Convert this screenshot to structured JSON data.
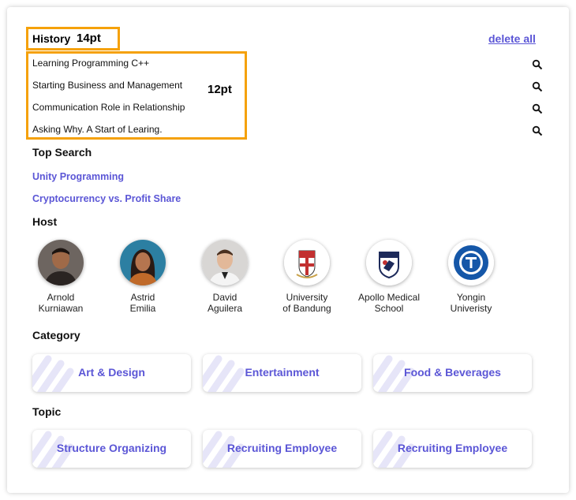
{
  "annotations": {
    "history_size": "14pt",
    "items_size": "12pt"
  },
  "history": {
    "title": "History",
    "delete_label": "delete all",
    "items": [
      "Learning Programming C++",
      "Starting Business and Management",
      "Communication Role in Relationship",
      "Asking Why. A Start of Learing."
    ]
  },
  "top_search": {
    "title": "Top Search",
    "items": [
      "Unity Programming",
      "Cryptocurrency vs. Profit Share"
    ]
  },
  "host": {
    "title": "Host",
    "items": [
      {
        "line1": "Arnold",
        "line2": "Kurniawan"
      },
      {
        "line1": "Astrid",
        "line2": "Emilia"
      },
      {
        "line1": "David",
        "line2": "Aguilera"
      },
      {
        "line1": "University",
        "line2": "of Bandung"
      },
      {
        "line1": "Apollo Medical",
        "line2": "School"
      },
      {
        "line1": "Yongin",
        "line2": "Univeristy"
      }
    ]
  },
  "category": {
    "title": "Category",
    "items": [
      "Art & Design",
      "Entertainment",
      "Food & Beverages"
    ]
  },
  "topic": {
    "title": "Topic",
    "items": [
      "Structure Organizing",
      "Recruiting Employee",
      "Recruiting Employee"
    ]
  },
  "colors": {
    "accent": "#5b56d6",
    "annotation": "#f5a10a"
  }
}
